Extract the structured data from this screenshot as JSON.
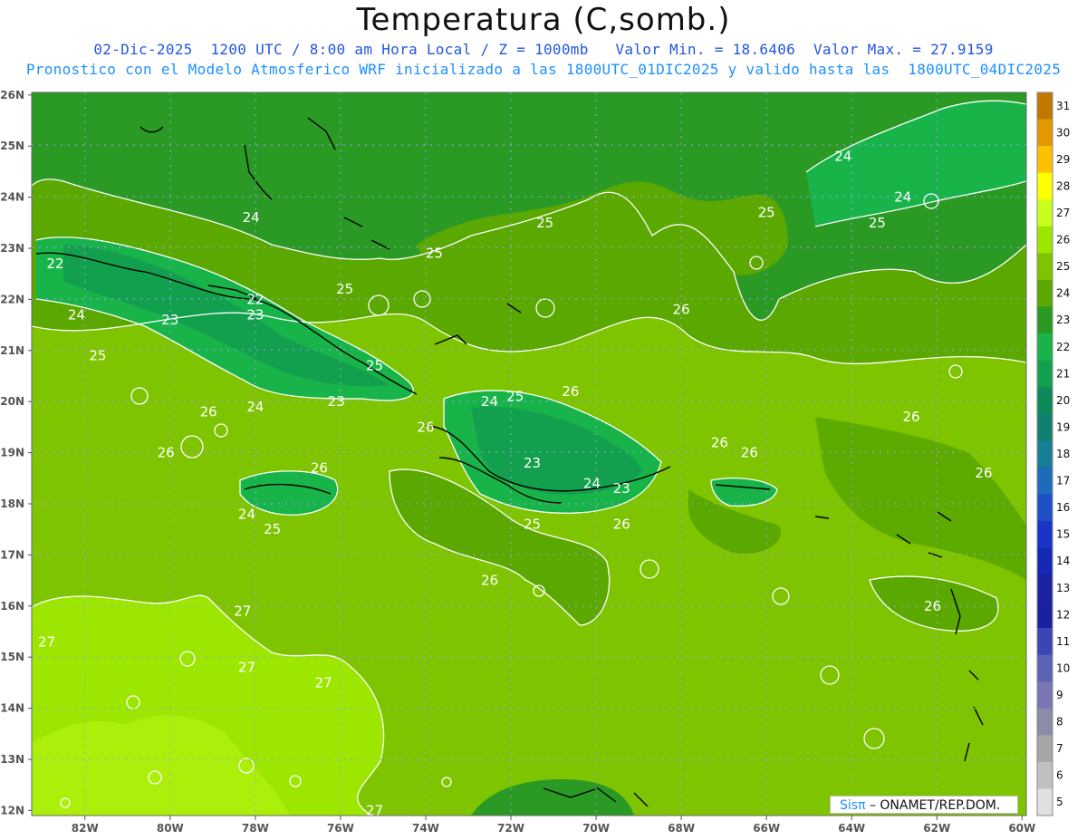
{
  "header": {
    "title": "Temperatura (C,somb.)",
    "line1": "02-Dic-2025  1200 UTC / 8:00 am Hora Local / Z = 1000mb   Valor Min. = 18.6406  Valor Max. = 27.9159",
    "line2": "Pronostico con el Modelo Atmosferico WRF inicializado a las 1800UTC_01DIC2025 y valido hasta las  1800UTC_04DIC2025"
  },
  "map": {
    "lat_labels": [
      "26N",
      "25N",
      "24N",
      "23N",
      "22N",
      "21N",
      "20N",
      "19N",
      "18N",
      "17N",
      "16N",
      "15N",
      "14N",
      "13N",
      "12N"
    ],
    "lon_labels": [
      "82W",
      "80W",
      "78W",
      "76W",
      "74W",
      "72W",
      "70W",
      "68W",
      "66W",
      "64W",
      "62W",
      "60W"
    ],
    "contour_labels": [
      {
        "text": "24",
        "lon": -78.1,
        "lat": 23.6
      },
      {
        "text": "25",
        "lon": -73.8,
        "lat": 22.9
      },
      {
        "text": "25",
        "lon": -71.2,
        "lat": 23.5
      },
      {
        "text": "25",
        "lon": -66.0,
        "lat": 23.7
      },
      {
        "text": "24",
        "lon": -64.2,
        "lat": 24.8
      },
      {
        "text": "24",
        "lon": -62.8,
        "lat": 24.0
      },
      {
        "text": "25",
        "lon": -63.4,
        "lat": 23.5
      },
      {
        "text": "22",
        "lon": -82.7,
        "lat": 22.7
      },
      {
        "text": "22",
        "lon": -78.0,
        "lat": 22.0
      },
      {
        "text": "25",
        "lon": -75.9,
        "lat": 22.2
      },
      {
        "text": "24",
        "lon": -82.2,
        "lat": 21.7
      },
      {
        "text": "23",
        "lon": -80.0,
        "lat": 21.6
      },
      {
        "text": "23",
        "lon": -78.0,
        "lat": 21.7
      },
      {
        "text": "26",
        "lon": -68.0,
        "lat": 21.8
      },
      {
        "text": "25",
        "lon": -81.7,
        "lat": 20.9
      },
      {
        "text": "25",
        "lon": -75.2,
        "lat": 20.7
      },
      {
        "text": "23",
        "lon": -76.1,
        "lat": 20.0
      },
      {
        "text": "24",
        "lon": -78.0,
        "lat": 19.9
      },
      {
        "text": "24",
        "lon": -72.5,
        "lat": 20.0
      },
      {
        "text": "25",
        "lon": -71.9,
        "lat": 20.1
      },
      {
        "text": "26",
        "lon": -70.6,
        "lat": 20.2
      },
      {
        "text": "26",
        "lon": -79.1,
        "lat": 19.8
      },
      {
        "text": "26",
        "lon": -74.0,
        "lat": 19.5
      },
      {
        "text": "26",
        "lon": -80.1,
        "lat": 19.0
      },
      {
        "text": "26",
        "lon": -67.1,
        "lat": 19.2
      },
      {
        "text": "26",
        "lon": -66.4,
        "lat": 19.0
      },
      {
        "text": "26",
        "lon": -62.6,
        "lat": 19.7
      },
      {
        "text": "26",
        "lon": -76.5,
        "lat": 18.7
      },
      {
        "text": "26",
        "lon": -60.9,
        "lat": 18.6
      },
      {
        "text": "23",
        "lon": -71.5,
        "lat": 18.8
      },
      {
        "text": "24",
        "lon": -70.1,
        "lat": 18.4
      },
      {
        "text": "23",
        "lon": -69.4,
        "lat": 18.3
      },
      {
        "text": "24",
        "lon": -78.2,
        "lat": 17.8
      },
      {
        "text": "25",
        "lon": -77.6,
        "lat": 17.5
      },
      {
        "text": "25",
        "lon": -71.5,
        "lat": 17.6
      },
      {
        "text": "26",
        "lon": -69.4,
        "lat": 17.6
      },
      {
        "text": "26",
        "lon": -72.5,
        "lat": 16.5
      },
      {
        "text": "26",
        "lon": -62.1,
        "lat": 16.0
      },
      {
        "text": "27",
        "lon": -78.3,
        "lat": 15.9
      },
      {
        "text": "27",
        "lon": -82.9,
        "lat": 15.3
      },
      {
        "text": "27",
        "lon": -78.2,
        "lat": 14.8
      },
      {
        "text": "27",
        "lon": -76.4,
        "lat": 14.5
      },
      {
        "text": "27",
        "lon": -75.2,
        "lat": 12.0
      }
    ],
    "legend": {
      "labels": [
        "31",
        "30",
        "29",
        "28",
        "27",
        "26",
        "25",
        "24",
        "23",
        "22",
        "21",
        "20",
        "19",
        "18",
        "17",
        "16",
        "15",
        "14",
        "13",
        "12",
        "11",
        "10",
        "9",
        "8",
        "7",
        "6",
        "5"
      ],
      "colors": [
        "#c07800",
        "#e39800",
        "#ffc000",
        "#ffff00",
        "#c8ff1e",
        "#9de600",
        "#7fc400",
        "#5aa800",
        "#2a9a24",
        "#18b44a",
        "#13a04e",
        "#0d8a5a",
        "#0f8070",
        "#167e95",
        "#1c6cb9",
        "#1e50c8",
        "#1a34c8",
        "#1428b4",
        "#1a22a0",
        "#1a20a0",
        "#3c46b0",
        "#5c62b4",
        "#7a76b4",
        "#8c8ca8",
        "#a6a6a6",
        "#c0c0c0",
        "#e0e0e0"
      ]
    },
    "credit": {
      "sis": "Sisπ",
      "rest": " – ONAMET/REP.DOM."
    }
  }
}
